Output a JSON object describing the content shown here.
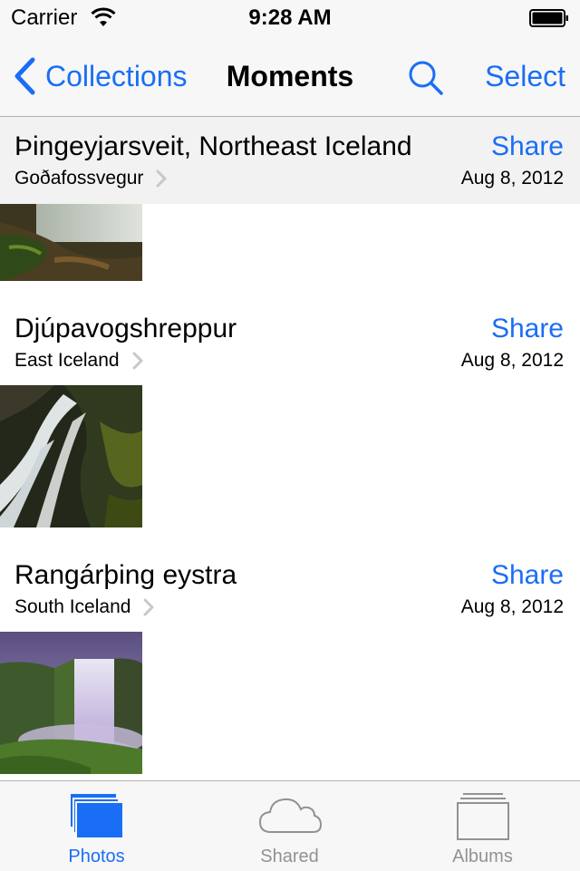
{
  "status_bar": {
    "carrier": "Carrier",
    "time": "9:28 AM"
  },
  "nav": {
    "back_label": "Collections",
    "title": "Moments",
    "select_label": "Select"
  },
  "moments": [
    {
      "title": "Þingeyjarsveit, Northeast Iceland",
      "subtitle": "Goðafossvegur",
      "share": "Share",
      "date": "Aug 8, 2012"
    },
    {
      "title": "Djúpavogshreppur",
      "subtitle": "East Iceland",
      "share": "Share",
      "date": "Aug 8, 2012"
    },
    {
      "title": "Rangárþing eystra",
      "subtitle": "South Iceland",
      "share": "Share",
      "date": "Aug 8, 2012"
    }
  ],
  "tabs": [
    {
      "label": "Photos",
      "icon": "photos-icon",
      "active": true
    },
    {
      "label": "Shared",
      "icon": "cloud-icon",
      "active": false
    },
    {
      "label": "Albums",
      "icon": "albums-icon",
      "active": false
    }
  ],
  "colors": {
    "accent": "#1a6ef5",
    "bar_background": "#f7f7f7",
    "inactive": "#929292"
  }
}
